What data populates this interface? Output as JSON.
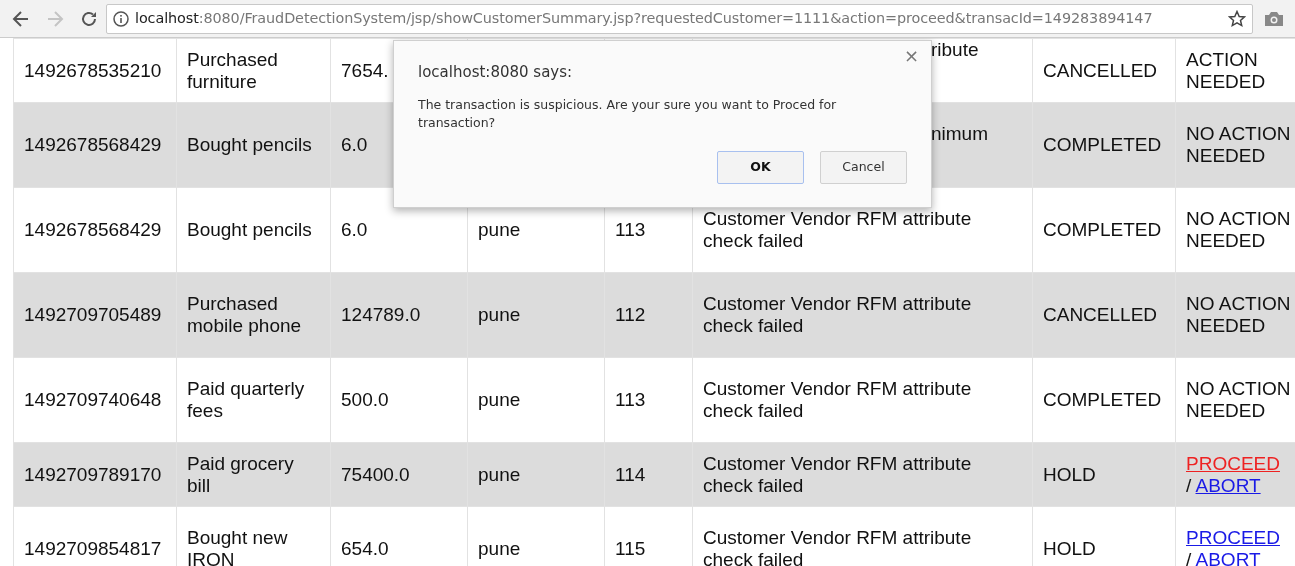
{
  "browser": {
    "url_host": "localhost",
    "url_rest": ":8080/FraudDetectionSystem/jsp/showCustomerSummary.jsp?requestedCustomer=1111&action=proceed&transacId=149283894147",
    "forward_disabled": true
  },
  "rows": [
    {
      "id": "1492678535210",
      "description": "Purchased furniture",
      "amount": "7654.",
      "reason": {
        "text": "ribute",
        "covered": true
      },
      "status": "CANCELLED",
      "action": {
        "kind": "text",
        "text": "ACTION NEEDED"
      }
    },
    {
      "id": "1492678568429",
      "description": "Bought pencils",
      "amount": "6.0",
      "reason": {
        "text": "nimum",
        "covered": true
      },
      "status": "COMPLETED",
      "action": {
        "kind": "text",
        "text": "NO ACTION NEEDED"
      }
    },
    {
      "id": "1492678568429",
      "description": "Bought pencils",
      "amount": "6.0",
      "city": "pune",
      "code": "113",
      "reason": {
        "text": "Customer Vendor RFM attribute check failed",
        "covered": false
      },
      "status": "COMPLETED",
      "action": {
        "kind": "text",
        "text": "NO ACTION NEEDED"
      }
    },
    {
      "id": "1492709705489",
      "description": "Purchased mobile phone",
      "amount": "124789.0",
      "city": "pune",
      "code": "112",
      "reason": {
        "text": "Customer Vendor RFM attribute check failed",
        "covered": false
      },
      "status": "CANCELLED",
      "action": {
        "kind": "text",
        "text": "NO ACTION NEEDED"
      }
    },
    {
      "id": "1492709740648",
      "description": "Paid quarterly fees",
      "amount": "500.0",
      "city": "pune",
      "code": "113",
      "reason": {
        "text": "Customer Vendor RFM attribute check failed",
        "covered": false
      },
      "status": "COMPLETED",
      "action": {
        "kind": "text",
        "text": "NO ACTION NEEDED"
      }
    },
    {
      "id": "1492709789170",
      "description": "Paid grocery bill",
      "amount": "75400.0",
      "city": "pune",
      "code": "114",
      "reason": {
        "text": "Customer Vendor RFM attribute check failed",
        "covered": false
      },
      "status": "HOLD",
      "action": {
        "kind": "links",
        "proceed": "PROCEED",
        "separator": "/",
        "abort": "ABORT",
        "proceed_active": true
      }
    },
    {
      "id": "1492709854817",
      "description": "Bought new IRON",
      "amount": "654.0",
      "city": "pune",
      "code": "115",
      "reason": {
        "text": "Customer Vendor RFM attribute check failed",
        "covered": false
      },
      "status": "HOLD",
      "action": {
        "kind": "links",
        "proceed": "PROCEED",
        "separator": "/",
        "abort": "ABORT",
        "proceed_active": false
      }
    }
  ],
  "dialog": {
    "title": "localhost:8080 says:",
    "message": "The transaction is suspicious. Are your sure you want to Proced for transaction?",
    "close": "×",
    "buttons": [
      {
        "label": "OK",
        "focused": true
      },
      {
        "label": "Cancel",
        "focused": false
      }
    ]
  }
}
